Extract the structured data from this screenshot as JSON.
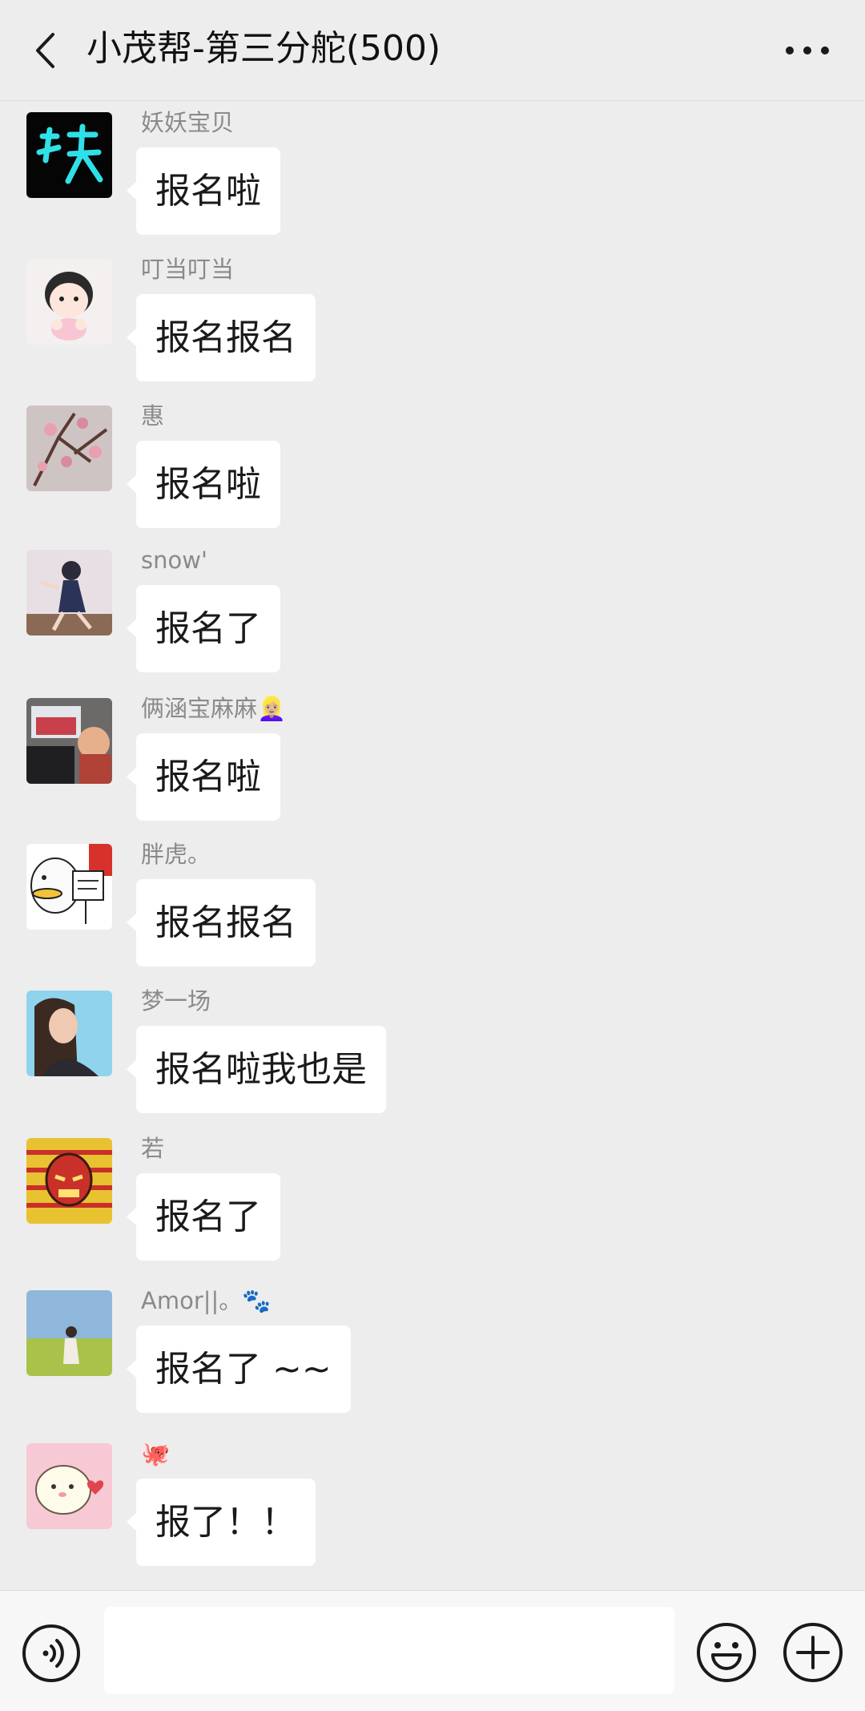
{
  "header": {
    "title": "小茂帮-第三分舵(500)"
  },
  "messages": [
    {
      "sender": "妖妖宝贝",
      "text": "报名啦",
      "avatar": "yao-character-avatar"
    },
    {
      "sender": "叮当叮当",
      "text": "报名报名",
      "avatar": "cartoon-girl-avatar"
    },
    {
      "sender": "惠",
      "text": "报名啦",
      "avatar": "peach-blossom-avatar"
    },
    {
      "sender": "snow'",
      "text": "报名了",
      "avatar": "anime-girl-avatar"
    },
    {
      "sender": "俩涵宝麻麻👱🏼‍♀️",
      "text": "报名啦",
      "avatar": "child-in-car-avatar"
    },
    {
      "sender": "胖虎。",
      "text": "报名报名",
      "avatar": "duck-sign-avatar"
    },
    {
      "sender": "梦一场",
      "text": "报名啦我也是",
      "avatar": "selfie-avatar"
    },
    {
      "sender": "若",
      "text": "报名了",
      "avatar": "iron-man-avatar"
    },
    {
      "sender": "Amor||。🐾",
      "text": "报名了 ~~",
      "avatar": "field-photo-avatar"
    },
    {
      "sender": "🐙",
      "text": "报了！！",
      "avatar": "cute-bear-avatar"
    }
  ],
  "input": {
    "placeholder": ""
  },
  "colors": {
    "background": "#ededed",
    "bubble": "#ffffff",
    "sender": "#8a8a8a"
  }
}
